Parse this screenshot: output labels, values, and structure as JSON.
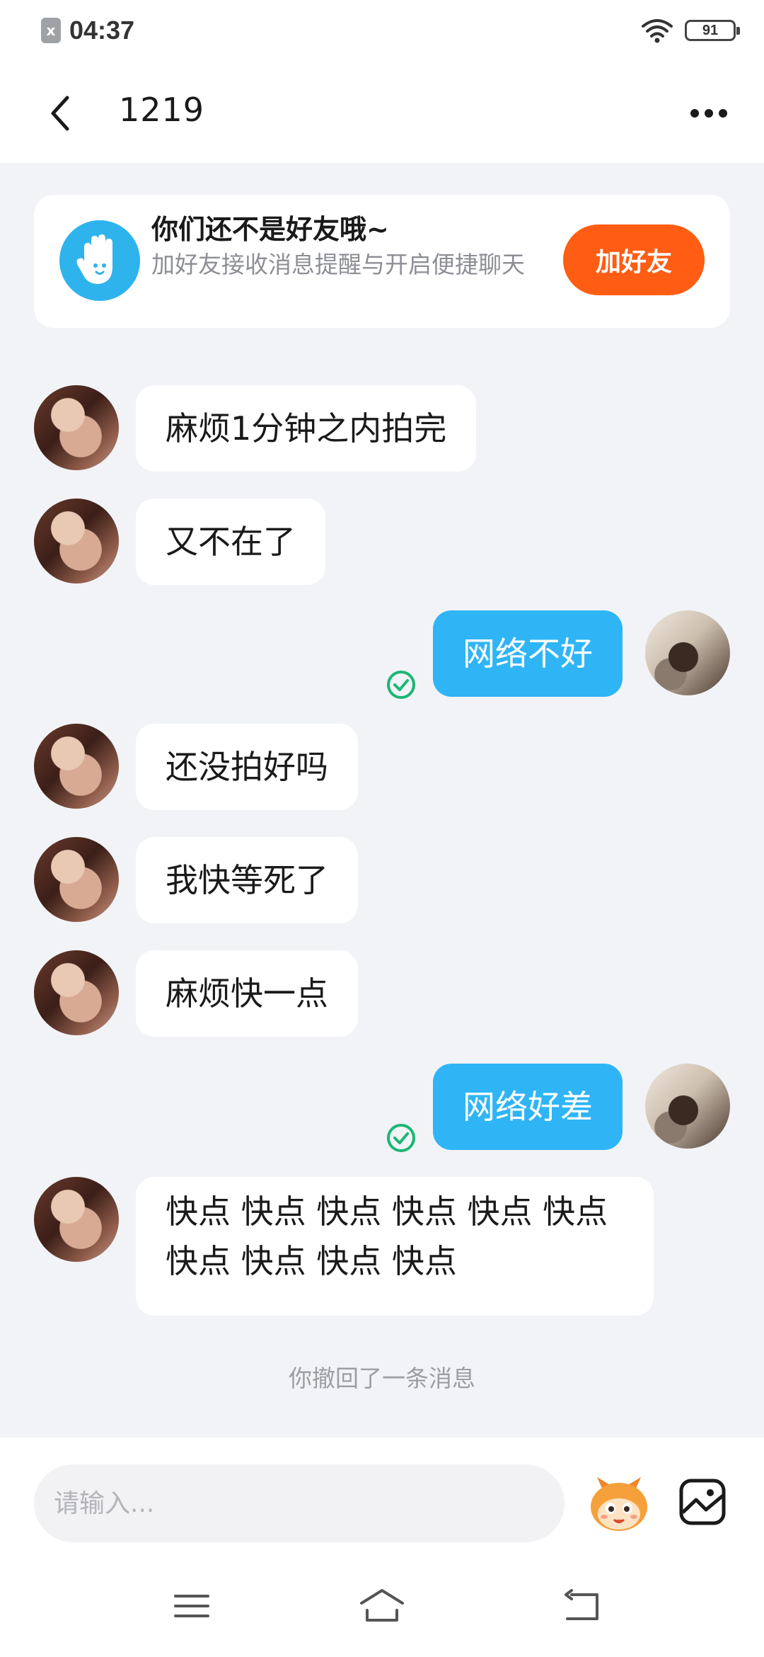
{
  "status_bar": {
    "time": "04:37",
    "battery": "91",
    "notification_icon": "x"
  },
  "header": {
    "title": "1219",
    "back_icon": "chevron-left-icon",
    "more_icon": "more-dots-icon"
  },
  "friend_card": {
    "title": "你们还不是好友哦~",
    "description": "加好友接收消息提醒与开启便捷聊天",
    "button_label": "加好友",
    "button_color": "#fe5d13"
  },
  "messages": [
    {
      "from": "other",
      "text": "麻烦1分钟之内拍完"
    },
    {
      "from": "other",
      "text": "又不在了"
    },
    {
      "from": "me",
      "text": "网络不好",
      "read": true
    },
    {
      "from": "other",
      "text": "还没拍好吗"
    },
    {
      "from": "other",
      "text": "我快等死了"
    },
    {
      "from": "other",
      "text": "麻烦快一点"
    },
    {
      "from": "me",
      "text": "网络好差",
      "read": true
    },
    {
      "from": "other",
      "text_line1": "快点 快点 快点 快点 快点 快点",
      "text_line2": "快点 快点 快点 快点"
    }
  ],
  "recall_notice": "你撤回了一条消息",
  "input": {
    "placeholder": "请输入..."
  },
  "colors": {
    "outgoing_bubble": "#2fb5f6",
    "incoming_bubble": "#ffffff",
    "background": "#f1f3f7",
    "read_check": "#1db675"
  }
}
